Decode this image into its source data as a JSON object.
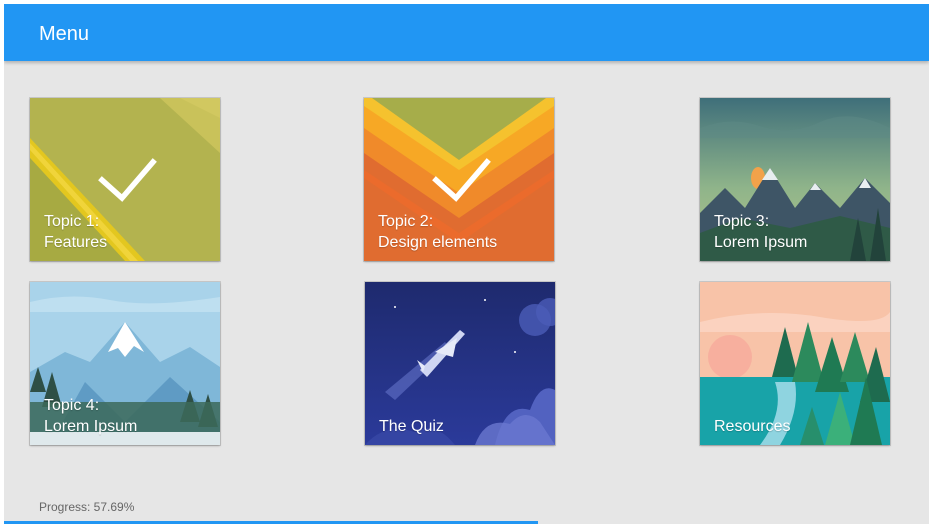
{
  "header": {
    "title": "Menu"
  },
  "tiles": [
    {
      "label": "Topic 1:\nFeatures",
      "completed": true
    },
    {
      "label": "Topic 2:\nDesign elements",
      "completed": true
    },
    {
      "label": "Topic 3:\nLorem Ipsum",
      "completed": false
    },
    {
      "label": "Topic 4:\nLorem Ipsum",
      "completed": false
    },
    {
      "label": "The Quiz",
      "completed": false
    },
    {
      "label": "Resources",
      "completed": false
    }
  ],
  "progress": {
    "label": "Progress: 57.69%",
    "percent": 57.69
  },
  "colors": {
    "appbar": "#2196f3",
    "background": "#e6e6e6",
    "progress": "#2196f3"
  }
}
